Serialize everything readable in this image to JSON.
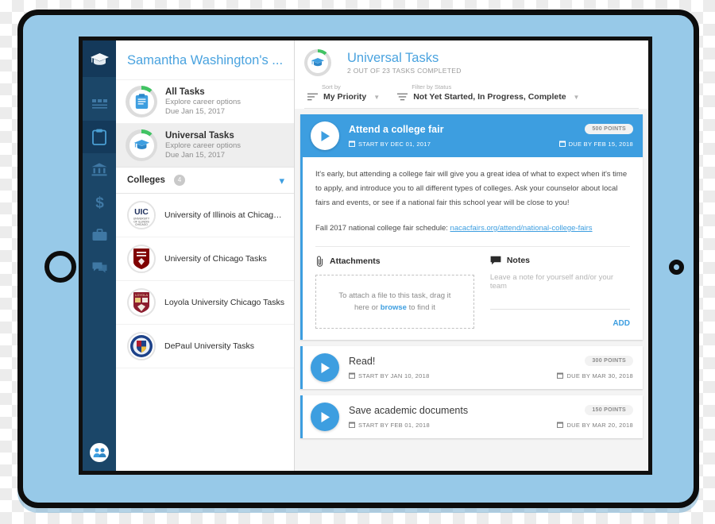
{
  "device": {
    "name": "tablet-frame",
    "home_button": "home-button-icon",
    "camera": "camera-icon"
  },
  "rail": {
    "logo": "graduation-cap-logo",
    "items": [
      {
        "name": "dashboard-icon",
        "active": false
      },
      {
        "name": "clipboard-tasks-icon",
        "active": true
      },
      {
        "name": "colleges-bank-icon",
        "active": false
      },
      {
        "name": "finances-dollar-icon",
        "active": false
      },
      {
        "name": "careers-briefcase-icon",
        "active": false
      },
      {
        "name": "messages-chat-icon",
        "active": false
      }
    ],
    "avatar": "user-group-avatar"
  },
  "sidebar": {
    "title": "Samantha Washington's ...",
    "task_groups": [
      {
        "title": "All Tasks",
        "subtitle": "Explore career options",
        "due": "Due Jan 15, 2017",
        "icon": "clipboard-icon",
        "selected": false
      },
      {
        "title": "Universal Tasks",
        "subtitle": "Explore career options",
        "due": "Due Jan 15, 2017",
        "icon": "graduation-cap-icon",
        "selected": true
      }
    ],
    "colleges_section": {
      "label": "Colleges",
      "count": "4",
      "chevron": "chevron-down-icon"
    },
    "colleges": [
      {
        "name": "University of Illinois at Chicago T...",
        "logo": "uic-logo"
      },
      {
        "name": "University of Chicago Tasks",
        "logo": "uchicago-logo"
      },
      {
        "name": "Loyola University Chicago Tasks",
        "logo": "loyola-logo"
      },
      {
        "name": "DePaul University Tasks",
        "logo": "depaul-logo"
      }
    ]
  },
  "main": {
    "header": {
      "title": "Universal Tasks",
      "subtitle": "2 OUT OF 23 TASKS COMPLETED",
      "avatar": "graduation-cap-progress-icon"
    },
    "controls": {
      "sort": {
        "label": "Sort by",
        "value": "My Priority",
        "icon": "sort-icon",
        "caret": "caret-down-icon"
      },
      "filter": {
        "label": "Filter by Status",
        "value": "Not Yet Started, In Progress, Complete",
        "icon": "filter-icon",
        "caret": "caret-down-icon"
      }
    },
    "expanded_task": {
      "title": "Attend a college fair",
      "points": "500 POINTS",
      "start": "START BY DEC 01, 2017",
      "due": "DUE BY FEB 15, 2018",
      "play_icon": "play-icon",
      "description": "It's early, but attending a college fair will give you a great idea of what to expect when it's time to apply, and introduce you to all different types of colleges. Ask your counselor about local fairs and events, or see if a national fair this school year will be close to you!",
      "link_prefix": "Fall 2017 national college fair schedule: ",
      "link_text": "nacacfairs.org/attend/national-college-fairs",
      "attachments": {
        "title": "Attachments",
        "icon": "paperclip-icon",
        "drop_text_before": "To attach a file to this task, drag it here or ",
        "drop_link": "browse",
        "drop_text_after": " to find it"
      },
      "notes": {
        "title": "Notes",
        "icon": "note-bubble-icon",
        "placeholder": "Leave a note for yourself and/or your team",
        "add_label": "ADD"
      }
    },
    "tasks": [
      {
        "title": "Read!",
        "points": "300 POINTS",
        "start": "START BY JAN 10, 2018",
        "due": "DUE BY MAR 30, 2018",
        "play_icon": "play-icon"
      },
      {
        "title": "Save academic documents",
        "points": "150 POINTS",
        "start": "START BY FEB 01, 2018",
        "due": "DUE BY MAR 20, 2018",
        "play_icon": "play-icon"
      }
    ]
  },
  "colors": {
    "accent_blue": "#3d9ee0",
    "rail_dark": "#1b4668",
    "device_body": "#97c9e8",
    "progress_green": "#41c363"
  }
}
